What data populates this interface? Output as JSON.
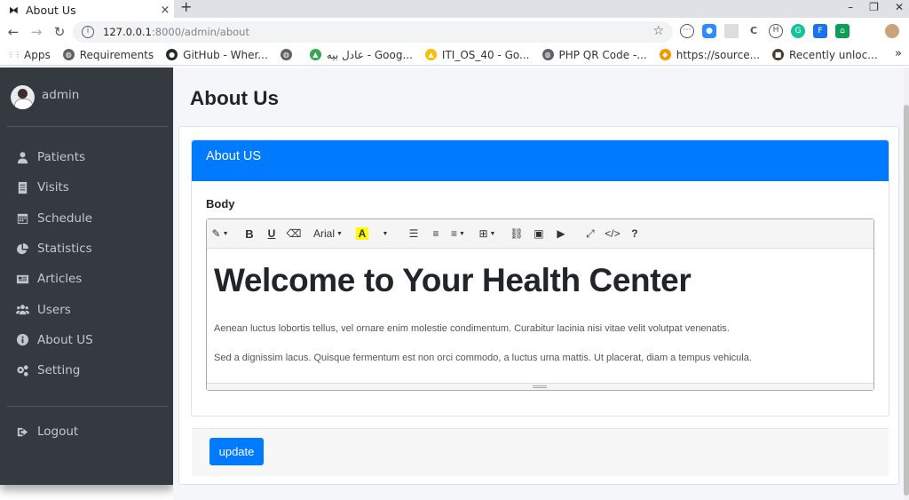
{
  "browser": {
    "tab_title": "About Us",
    "tab_close": "×",
    "new_tab": "+",
    "url_host": "127.0.0.1",
    "url_path": ":8000/admin/about",
    "bookmarks": [
      {
        "label": "Apps",
        "icon": "apps-grid-icon",
        "color": "#e8453c"
      },
      {
        "label": "Requirements",
        "icon": "globe-icon",
        "color": "#5f6368"
      },
      {
        "label": "GitHub - Wher...",
        "icon": "github-icon",
        "color": "#24292e"
      },
      {
        "label": "",
        "icon": "globe-icon",
        "color": "#5f6368"
      },
      {
        "label": "عادل بيه - Goog...",
        "icon": "google-drive-icon",
        "color": "#34a853"
      },
      {
        "label": "ITI_OS_40 - Go...",
        "icon": "google-drive-icon",
        "color": "#fbbc04"
      },
      {
        "label": "PHP QR Code -...",
        "icon": "globe-icon",
        "color": "#5f6368"
      },
      {
        "label": "https://source...",
        "icon": "diamond-icon",
        "color": "#f29900"
      },
      {
        "label": "Recently unloc...",
        "icon": "app-icon",
        "color": "#4a3c2c"
      }
    ],
    "bookmarks_more": "»"
  },
  "sidebar": {
    "username": "admin",
    "items": [
      {
        "label": "Patients",
        "icon": "user-injured-icon"
      },
      {
        "label": "Visits",
        "icon": "file-list-icon"
      },
      {
        "label": "Schedule",
        "icon": "calendar-icon"
      },
      {
        "label": "Statistics",
        "icon": "pie-chart-icon"
      },
      {
        "label": "Articles",
        "icon": "newspaper-icon"
      },
      {
        "label": "Users",
        "icon": "users-icon"
      },
      {
        "label": "About US",
        "icon": "info-circle-icon"
      },
      {
        "label": "Setting",
        "icon": "gears-icon"
      }
    ],
    "logout": "Logout"
  },
  "main": {
    "page_title": "About Us",
    "card_header": "About US",
    "body_label": "Body",
    "editor": {
      "font_name": "Arial",
      "heading": "Welcome to Your Health Center",
      "paragraphs": [
        "Aenean luctus lobortis tellus, vel ornare enim molestie condimentum. Curabitur lacinia nisi vitae velit volutpat venenatis.",
        "Sed a dignissim lacus. Quisque fermentum est non orci commodo, a luctus urna mattis. Ut placerat, diam a tempus vehicula."
      ]
    },
    "update_button": "update"
  },
  "colors": {
    "sidebar_bg": "#343a40",
    "primary": "#007bff",
    "page_bg": "#f4f6f9"
  }
}
